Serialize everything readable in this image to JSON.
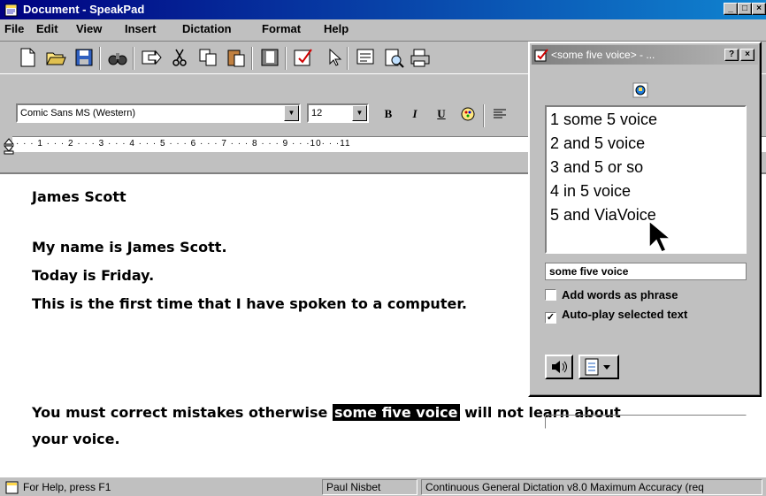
{
  "window": {
    "title": "Document - SpeakPad"
  },
  "menu": [
    "File",
    "Edit",
    "View",
    "Insert",
    "Dictation",
    "Format",
    "Help"
  ],
  "format_bar": {
    "font": "Comic Sans MS (Western)",
    "size": "12",
    "bold": "B",
    "italic": "I",
    "underline": "U"
  },
  "ruler": {
    "ticks": "· · · 1 · · · 2 · · · 3 · · · 4 · · · 5 · · · 6 · · · 7 · · · 8 · · · 9 · · ·10· · ·11"
  },
  "document": {
    "lines": [
      "James Scott",
      "My name is James Scott.",
      "Today is Friday.",
      "This is the first time that I have spoken to a computer."
    ],
    "para_before": "You must correct mistakes otherwise ",
    "para_highlight": "some five voice",
    "para_after": " will not learn about",
    "para_line2": "your voice."
  },
  "status": {
    "help": "For Help, press F1",
    "user": "Paul Nisbet",
    "mode": "Continuous General Dictation v8.0 Maximum Accuracy (req"
  },
  "dialog": {
    "title": "<some five voice> - ...",
    "help": "?",
    "close": "×",
    "choices": [
      "1 some 5 voice",
      "2 and 5 voice",
      "3 and 5 or so",
      "4 in 5 voice",
      "5 and ViaVoice"
    ],
    "text": "some five voice",
    "add_words": "Add words as phrase",
    "autoplay": "Auto-play selected text",
    "add_words_checked": false,
    "autoplay_checked": true
  }
}
